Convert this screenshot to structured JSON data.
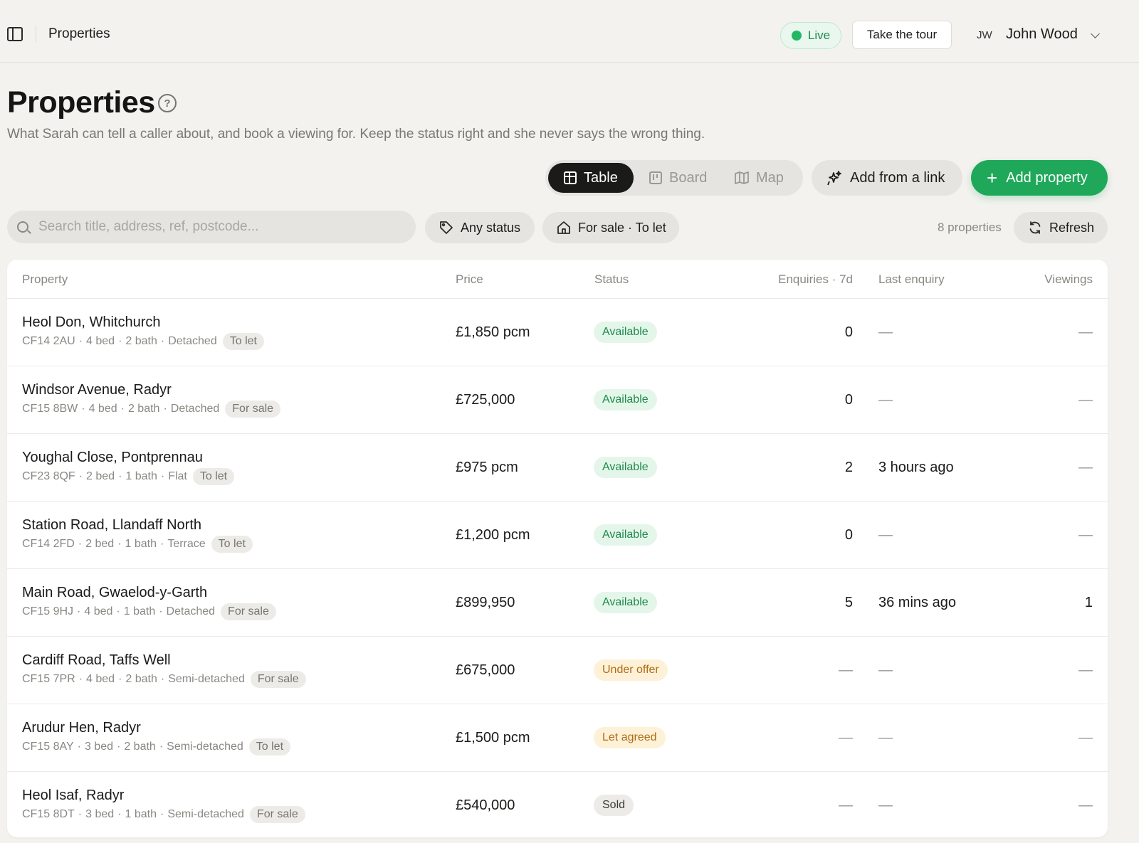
{
  "topbar": {
    "title": "Properties",
    "live_label": "Live",
    "tour_label": "Take the tour",
    "user_initials": "JW",
    "user_name": "John Wood"
  },
  "header": {
    "title": "Properties",
    "subtitle": "What Sarah can tell a caller about, and book a viewing for. Keep the status right and she never says the wrong thing."
  },
  "views": {
    "table": "Table",
    "board": "Board",
    "map": "Map",
    "active": "Table"
  },
  "actions": {
    "add_from_link": "Add from a link",
    "add_property": "Add property"
  },
  "filters": {
    "search_placeholder": "Search title, address, ref, postcode...",
    "status": "Any status",
    "type": "For sale · To let",
    "count": "8 properties",
    "refresh": "Refresh"
  },
  "colors": {
    "accent": "#1fa85a",
    "live": "#22b863",
    "available_bg": "#e4f6ea",
    "warning_bg": "#fdf1d7"
  },
  "table": {
    "columns": [
      "Property",
      "Price",
      "Status",
      "Enquiries · 7d",
      "Last enquiry",
      "Viewings"
    ],
    "rows": [
      {
        "title": "Heol Don, Whitchurch",
        "postcode": "CF14 2AU",
        "beds": "4 bed",
        "baths": "2 bath",
        "style": "Detached",
        "type": "To let",
        "price": "£1,850 pcm",
        "status": "Available",
        "enquiries": "0",
        "last": "—",
        "viewings": "—"
      },
      {
        "title": "Windsor Avenue, Radyr",
        "postcode": "CF15 8BW",
        "beds": "4 bed",
        "baths": "2 bath",
        "style": "Detached",
        "type": "For sale",
        "price": "£725,000",
        "status": "Available",
        "enquiries": "0",
        "last": "—",
        "viewings": "—"
      },
      {
        "title": "Youghal Close, Pontprennau",
        "postcode": "CF23 8QF",
        "beds": "2 bed",
        "baths": "1 bath",
        "style": "Flat",
        "type": "To let",
        "price": "£975 pcm",
        "status": "Available",
        "enquiries": "2",
        "last": "3 hours ago",
        "viewings": "—"
      },
      {
        "title": "Station Road, Llandaff North",
        "postcode": "CF14 2FD",
        "beds": "2 bed",
        "baths": "1 bath",
        "style": "Terrace",
        "type": "To let",
        "price": "£1,200 pcm",
        "status": "Available",
        "enquiries": "0",
        "last": "—",
        "viewings": "—"
      },
      {
        "title": "Main Road, Gwaelod-y-Garth",
        "postcode": "CF15 9HJ",
        "beds": "4 bed",
        "baths": "1 bath",
        "style": "Detached",
        "type": "For sale",
        "price": "£899,950",
        "status": "Available",
        "enquiries": "5",
        "last": "36 mins ago",
        "viewings": "1"
      },
      {
        "title": "Cardiff Road, Taffs Well",
        "postcode": "CF15 7PR",
        "beds": "4 bed",
        "baths": "2 bath",
        "style": "Semi-detached",
        "type": "For sale",
        "price": "£675,000",
        "status": "Under offer",
        "enquiries": "—",
        "last": "—",
        "viewings": "—"
      },
      {
        "title": "Arudur Hen, Radyr",
        "postcode": "CF15 8AY",
        "beds": "3 bed",
        "baths": "2 bath",
        "style": "Semi-detached",
        "type": "To let",
        "price": "£1,500 pcm",
        "status": "Let agreed",
        "enquiries": "—",
        "last": "—",
        "viewings": "—"
      },
      {
        "title": "Heol Isaf, Radyr",
        "postcode": "CF15 8DT",
        "beds": "3 bed",
        "baths": "1 bath",
        "style": "Semi-detached",
        "type": "For sale",
        "price": "£540,000",
        "status": "Sold",
        "enquiries": "—",
        "last": "—",
        "viewings": "—"
      }
    ]
  }
}
